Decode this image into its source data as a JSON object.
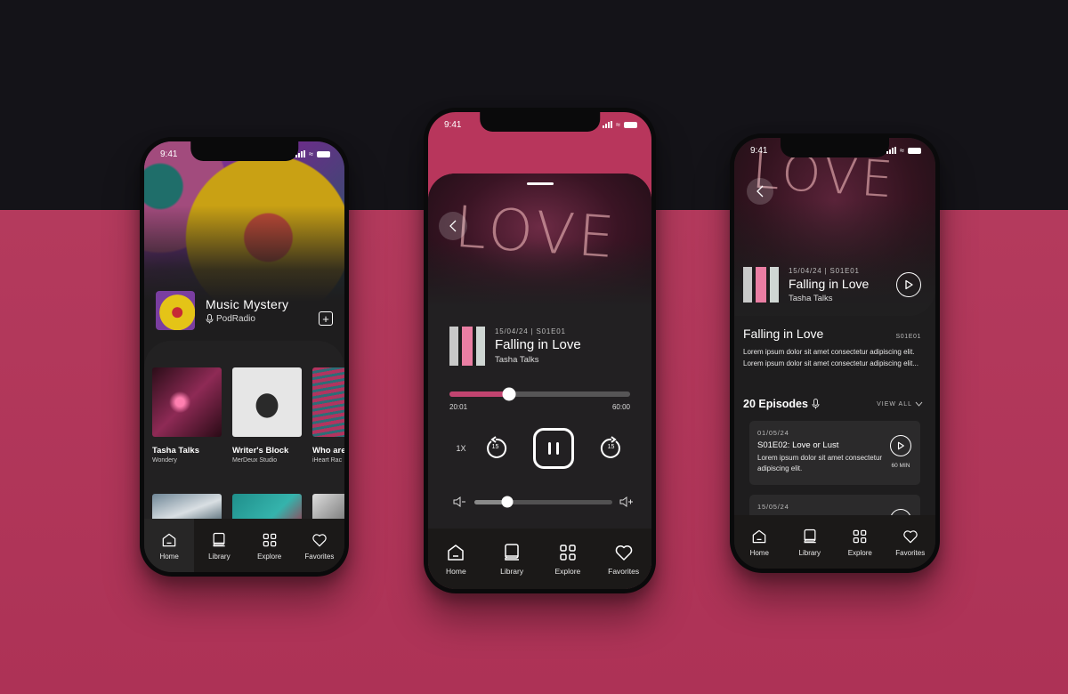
{
  "colors": {
    "accent": "#b8365c",
    "background_dark": "#141318",
    "surface": "#222022"
  },
  "status_bar": {
    "time": "9:41"
  },
  "navbar": {
    "items": [
      {
        "icon": "home-icon",
        "label": "Home"
      },
      {
        "icon": "library-icon",
        "label": "Library"
      },
      {
        "icon": "explore-icon",
        "label": "Explore"
      },
      {
        "icon": "favorites-icon",
        "label": "Favorites"
      }
    ]
  },
  "home_screen": {
    "featured": {
      "title": "Music Mystery",
      "publisher": "PodRadio",
      "add_label": "+"
    },
    "cards": [
      {
        "title": "Tasha Talks",
        "subtitle": "Wondery"
      },
      {
        "title": "Writer's Block",
        "subtitle": "MerDeux Studio"
      },
      {
        "title": "Who are",
        "subtitle": "iHeart Rac"
      }
    ],
    "active_nav": "Home"
  },
  "player_screen": {
    "episode": {
      "meta": "15/04/24 | S01E01",
      "title": "Falling in Love",
      "show": "Tasha Talks"
    },
    "progress": {
      "current": "20:01",
      "total": "60:00",
      "fraction": 0.33
    },
    "controls": {
      "speed": "1X",
      "rewind": "15",
      "forward": "15"
    },
    "volume": {
      "fraction": 0.24
    }
  },
  "detail_screen": {
    "episode": {
      "meta": "15/04/24 | S01E01",
      "title": "Falling in Love",
      "show": "Tasha Talks"
    },
    "heading": "Falling in Love",
    "code": "S01E01",
    "description": "Lorem ipsum dolor sit amet consectetur adipiscing elit. Lorem ipsum dolor sit amet consectetur adipiscing elit...",
    "episodes_title": "20 Episodes",
    "view_all": "VIEW ALL",
    "episode_list": [
      {
        "date": "01/05/24",
        "title": "S01E02: Love or Lust",
        "desc": "Lorem ipsum dolor sit amet consectetur adipiscing elit.",
        "duration": "60 MIN"
      },
      {
        "date": "15/05/24",
        "title": "",
        "desc": "",
        "duration": ""
      }
    ]
  },
  "hero_text": "LOVE"
}
